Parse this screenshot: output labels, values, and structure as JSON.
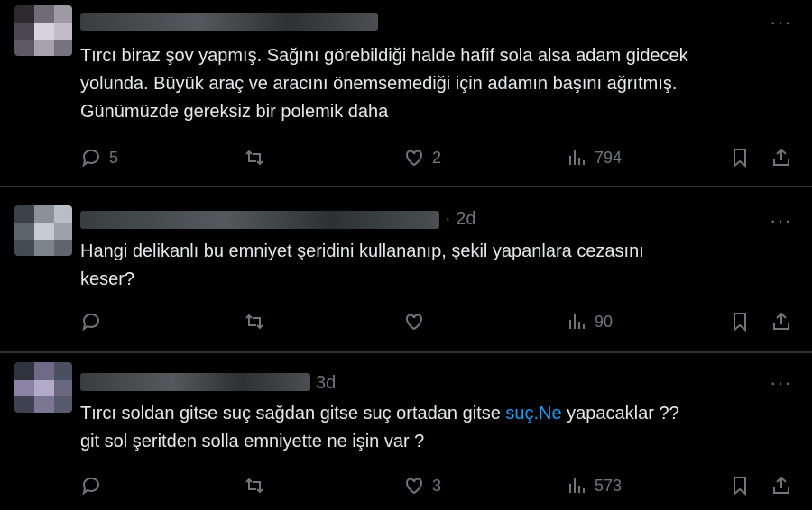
{
  "tweets": [
    {
      "time": "",
      "text_lines": [
        "Tırcı biraz şov yapmış. Sağını görebildiği halde hafif sola alsa adam gidecek",
        "yolunda. Büyük araç ve aracını önemsemediği için adamın başını ağrıtmış.",
        "Günümüzde gereksiz bir polemik daha"
      ],
      "replies": "5",
      "reposts": "",
      "likes": "2",
      "views": "794"
    },
    {
      "time": "· 2d",
      "text_lines": [
        "Hangi delikanlı bu emniyet şeridini kullananıp, şekil yapanlara cezasını",
        "keser?"
      ],
      "replies": "",
      "reposts": "",
      "likes": "",
      "views": "90"
    },
    {
      "time": "3d",
      "text_line1_before": "Tırcı soldan gitse suç sağdan gitse suç ortadan gitse ",
      "text_line1_link": "suç.Ne",
      "text_line1_after": " yapacaklar ??",
      "text_line2": "git sol şeritden solla emniyette ne işin var ?",
      "replies": "",
      "reposts": "",
      "likes": "3",
      "views": "573"
    }
  ],
  "more_label": "···",
  "colors": {
    "background": "#000000",
    "text": "#e7e9ea",
    "muted": "#71767b",
    "link": "#1d9bf0",
    "divider": "#2f3336"
  },
  "icons": [
    "reply-icon",
    "repost-icon",
    "like-icon",
    "views-icon",
    "bookmark-icon",
    "share-icon"
  ]
}
